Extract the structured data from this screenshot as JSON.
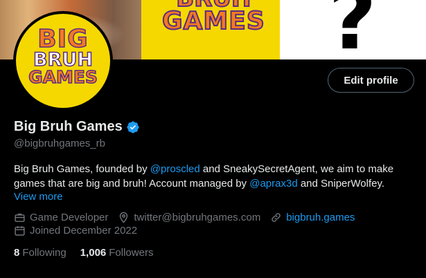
{
  "banner": {
    "logo_line1": "BRUH",
    "logo_line2": "GAMES",
    "right_glyph": "?"
  },
  "avatar": {
    "line1": "BIG",
    "line2": "BRUH",
    "line3": "GAMES"
  },
  "edit_profile_label": "Edit profile",
  "profile": {
    "name": "Big Bruh Games",
    "handle": "@bigbruhgames_rb",
    "verified_color": "#1d9bf0"
  },
  "bio": {
    "part1": "Big Bruh Games, founded by ",
    "mention1": "@proscled",
    "part2": " and SneakySecretAgent, we aim to make games that are big and bruh! Account managed by ",
    "mention2": "@aprax3d",
    "part3": " and SniperWolfey."
  },
  "view_more_label": "View more",
  "meta": {
    "category": "Game Developer",
    "location": "twitter@bigbruhgames.com",
    "website": "bigbruh.games",
    "joined": "Joined December 2022"
  },
  "stats": {
    "following_count": "8",
    "following_label": "Following",
    "followers_count": "1,006",
    "followers_label": "Followers"
  },
  "colors": {
    "background": "#000000",
    "accent": "#1d9bf0",
    "muted": "#71767b",
    "brand_yellow": "#f5d800",
    "brand_orange": "#f37b1f"
  }
}
